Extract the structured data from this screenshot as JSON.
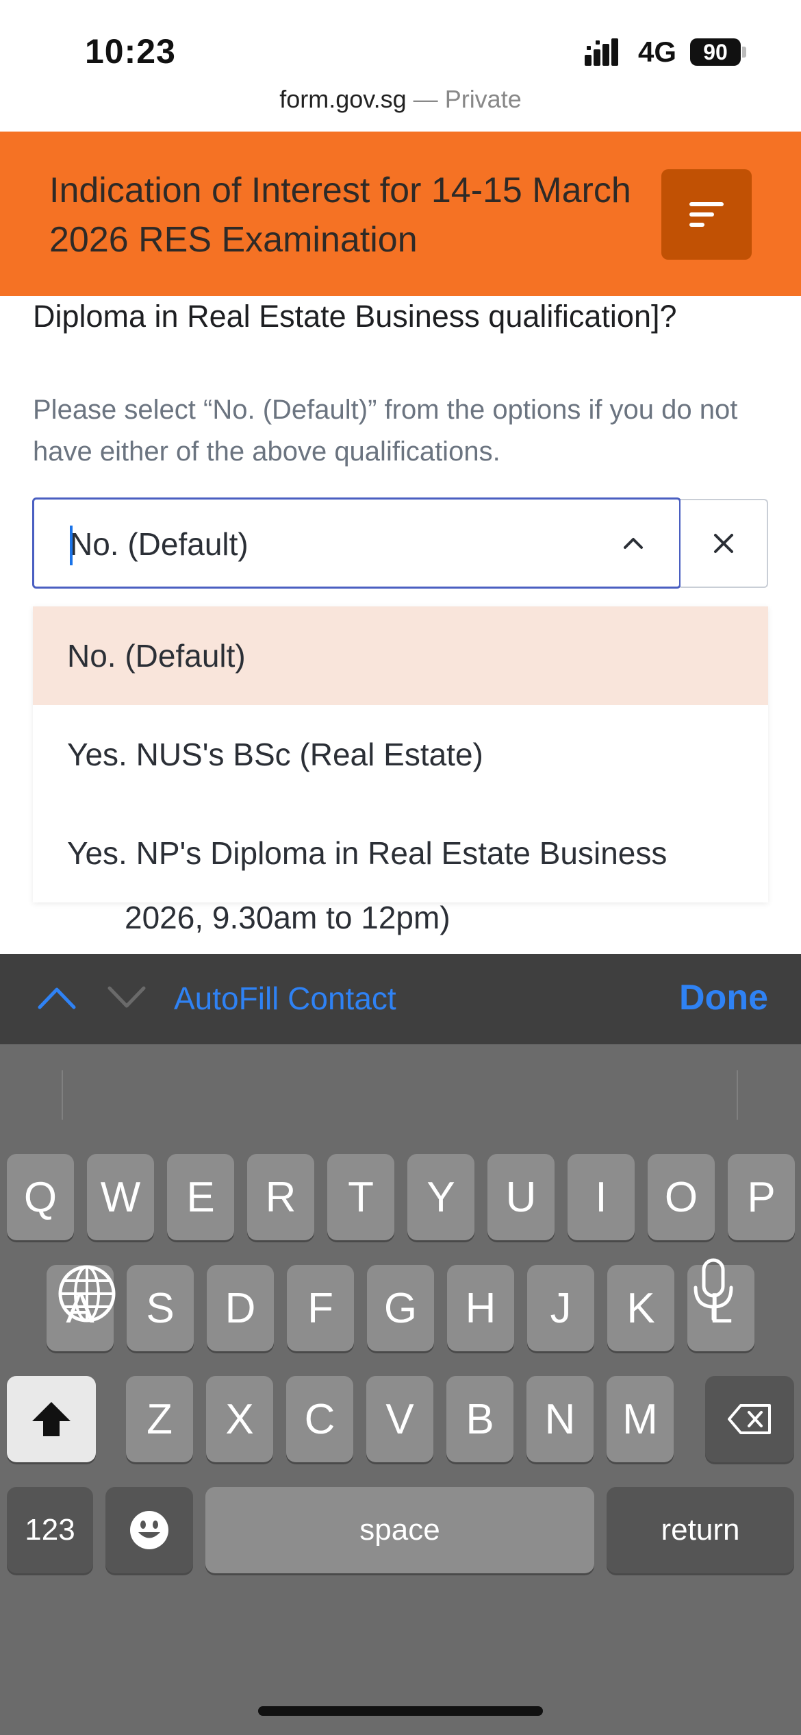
{
  "status_bar": {
    "time": "10:23",
    "network": "4G",
    "battery": "90"
  },
  "browser": {
    "domain": "form.gov.sg",
    "separator": " — ",
    "mode": "Private"
  },
  "header": {
    "title": "Indication of Interest for 14-15 March 2026 RES Examination",
    "menu_icon": "menu-icon"
  },
  "question": {
    "text": "Diploma in Real Estate Business qualification]?",
    "hint": "Please select “No. (Default)” from the options if you do not have either of the above qualifications."
  },
  "select": {
    "value": "No. (Default)",
    "options": [
      "No. (Default)",
      "Yes. NUS's BSc (Real Estate)",
      "Yes. NP's Diploma in Real Estate Business"
    ],
    "selected_index": 0
  },
  "behind_text": "2026, 9.30am to 12pm)",
  "accessory": {
    "autofill_label": "AutoFill Contact",
    "done_label": "Done"
  },
  "keyboard": {
    "row1": [
      "Q",
      "W",
      "E",
      "R",
      "T",
      "Y",
      "U",
      "I",
      "O",
      "P"
    ],
    "row2": [
      "A",
      "S",
      "D",
      "F",
      "G",
      "H",
      "J",
      "K",
      "L"
    ],
    "row3": [
      "Z",
      "X",
      "C",
      "V",
      "B",
      "N",
      "M"
    ],
    "numbers_label": "123",
    "space_label": "space",
    "return_label": "return"
  },
  "colors": {
    "header": "#f57224",
    "menu_button": "#c15104",
    "accent_blue": "#2f82f4",
    "selected_option": "#f9e5db"
  }
}
